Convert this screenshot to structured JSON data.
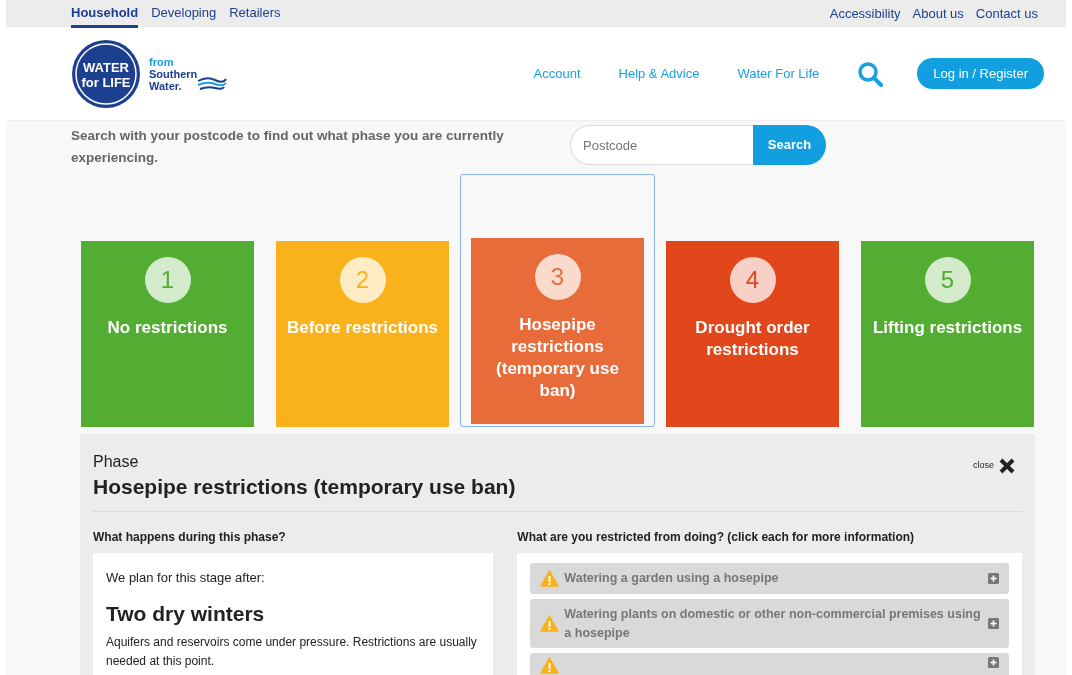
{
  "top_nav": {
    "left": [
      {
        "label": "Household",
        "selected": true
      },
      {
        "label": "Developing",
        "selected": false
      },
      {
        "label": "Retailers",
        "selected": false
      }
    ],
    "right": [
      "Accessibility",
      "About us",
      "Contact us"
    ]
  },
  "header": {
    "logo_text": [
      "WATER",
      "for LIFE"
    ],
    "tagline": [
      "from",
      "Southern",
      "Water."
    ],
    "menu": [
      "Account",
      "Help & Advice",
      "Water For Life"
    ],
    "login_button": "Log in / Register"
  },
  "search": {
    "prompt": "Search with your postcode to find out what phase you are currently experiencing.",
    "placeholder": "Postcode",
    "button": "Search"
  },
  "phases": [
    {
      "number": "1",
      "label": "No restrictions",
      "color": "#52ad32",
      "selected": false
    },
    {
      "number": "2",
      "label": "Before restrictions",
      "color": "#f9b21b",
      "selected": false
    },
    {
      "number": "3",
      "label": "Hosepipe restrictions (temporary use ban)",
      "color": "#e86b3a",
      "selected": true
    },
    {
      "number": "4",
      "label": "Drought order restrictions",
      "color": "#e2461b",
      "selected": false
    },
    {
      "number": "5",
      "label": "Lifting restrictions",
      "color": "#52ad32",
      "selected": false
    }
  ],
  "detail": {
    "kicker": "Phase",
    "title": "Hosepipe restrictions (temporary use ban)",
    "close_label": "close",
    "left_heading": "What happens during this phase?",
    "intro": "We plan for this stage after:",
    "subtitle": "Two dry winters",
    "body": "Aquifers and reservoirs come under pressure. Restrictions are usually needed at this point.",
    "right_heading": "What are you restricted from doing? (click each for more information)",
    "restrictions": [
      {
        "label": "Watering a garden using a hosepipe",
        "expanded": false
      },
      {
        "label": "Watering plants on domestic or other non-commercial premises using a hosepipe",
        "expanded": false
      }
    ],
    "more_below": true
  }
}
